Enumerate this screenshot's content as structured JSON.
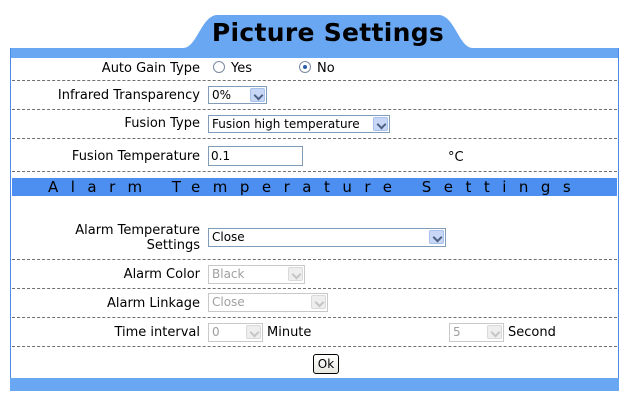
{
  "header": {
    "title": "Picture Settings"
  },
  "picture": {
    "auto_gain": {
      "label": "Auto Gain Type",
      "options": [
        "Yes",
        "No"
      ],
      "selected": "No"
    },
    "infrared": {
      "label": "Infrared Transparency",
      "value": "0%"
    },
    "fusion_type": {
      "label": "Fusion Type",
      "value": "Fusion high temperature"
    },
    "fusion_temp": {
      "label": "Fusion Temperature",
      "value": "0.1",
      "unit": "°C"
    }
  },
  "alarm": {
    "section_title": "Alarm Temperature Settings",
    "settings": {
      "label_line1": "Alarm Temperature",
      "label_line2": "Settings",
      "value": "Close"
    },
    "color": {
      "label": "Alarm Color",
      "value": "Black"
    },
    "linkage": {
      "label": "Alarm Linkage",
      "value": "Close"
    },
    "interval": {
      "label": "Time interval",
      "minute_value": "0",
      "minute_unit": "Minute",
      "second_value": "5",
      "second_unit": "Second"
    }
  },
  "actions": {
    "ok_label": "Ok"
  },
  "colors": {
    "accent": "#4d8ff0",
    "tab": "#6aa7f2"
  }
}
